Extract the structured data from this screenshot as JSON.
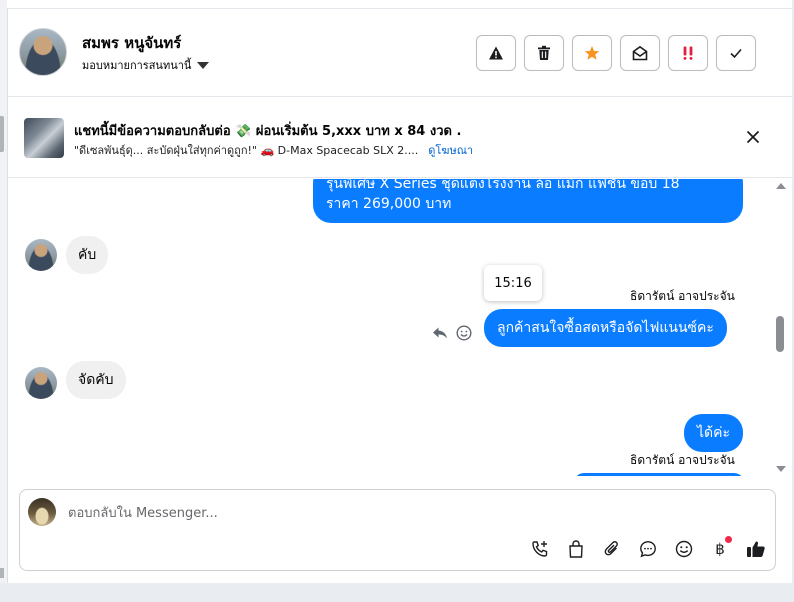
{
  "contact": {
    "name": "สมพร หนูจันทร์",
    "assign_label": "มอบหมายการสนทนานี้"
  },
  "header_actions": [
    {
      "name": "spam-warning",
      "icon": "warning-icon"
    },
    {
      "name": "delete",
      "icon": "trash-icon"
    },
    {
      "name": "star",
      "icon": "star-icon",
      "color": "#f7931e"
    },
    {
      "name": "mark-unread",
      "icon": "open-envelope-icon"
    },
    {
      "name": "important",
      "icon": "double-exclamation-icon",
      "color": "#e41e3f"
    },
    {
      "name": "mark-done",
      "icon": "check-icon"
    }
  ],
  "ad": {
    "title": "แชทนี้มีข้อความตอบกลับต่อ 💸 ผ่อนเริ่มต้น 5,xxx บาท x 84 งวด .",
    "subtitle": "\"ดีเซลพันธุ์ดุ... สะบัดฝุ่นใส่ทุกค่าดูถูก!\" 🚗 D-Max Spacecab SLX 2....",
    "link": "ดูโฆษณา"
  },
  "messages": {
    "outgoing_partial": "รุ่นพิเศษ X Series ชุดแต่งโรงงาน ล้อ แม็ก แฟชั่น ขอบ 18",
    "outgoing_price": "ราคา 269,000 บาท",
    "incoming_1": "คับ",
    "timestamp": "15:16",
    "sender_1": "ธิดารัตน์ อาจประจัน",
    "outgoing_1": "ลูกค้าสนใจซื้อสดหรือจัดไฟแนนซ์คะ",
    "incoming_2": "จัดคับ",
    "outgoing_2": "ได้ค่ะ",
    "sender_2": "ธิดารัตน์ อาจประจัน"
  },
  "composer": {
    "placeholder": "ตอบกลับใน Messenger..."
  },
  "composer_tools": [
    "call-add-icon",
    "shopping-bag-icon",
    "paperclip-icon",
    "chat-bubble-icon",
    "emoji-icon",
    "baht-icon",
    "thumbs-up-icon"
  ],
  "colors": {
    "accent": "#0a7cff",
    "link": "#0064d1",
    "notification_dot": "#f02849"
  }
}
